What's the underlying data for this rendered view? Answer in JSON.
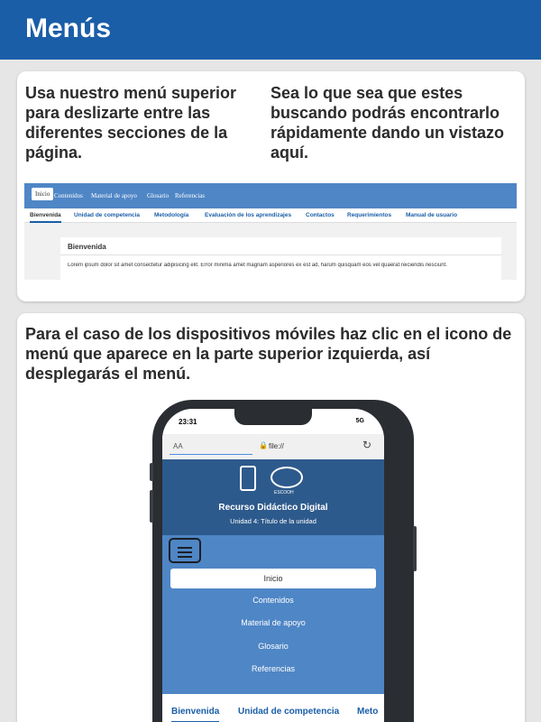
{
  "header": {
    "title": "Menús"
  },
  "card1": {
    "left_text": "Usa nuestro menú superior para deslizarte entre las diferentes secciones de la página.",
    "right_text": "Sea lo que sea que estes buscando podrás encontrarlo rápidamente dando un vistazo aquí."
  },
  "desktop": {
    "nav": [
      "Inicio",
      "Contenidos",
      "Material de apoyo",
      "Glosario",
      "Referencias"
    ],
    "tabs": [
      "Bienvenida",
      "Unidad de competencia",
      "Metodología",
      "Evaluación de los aprendizajes",
      "Contactos",
      "Requerimientos",
      "Manual de usuario"
    ],
    "box_title": "Bienvenida",
    "lorem": "Lorem ipsum dolor sit amet consectetur adipisicing elit. Error minima amet magnam asperiores ex est ad, harum quisquam eos vel quaerat reiciendis nesciunt."
  },
  "card2": {
    "text": "Para el caso de los dispositivos móviles haz clic en el icono de menú que aparece en la parte superior izquierda, así desplegarás el menú."
  },
  "phone": {
    "time": "23:31",
    "signal": "5G",
    "aa": "AA",
    "url": "file://",
    "logo_text": "ESCOOH",
    "title": "Recurso Didáctico Digital",
    "subtitle": "Unidad 4: Título de la unidad",
    "menu": [
      "Inicio",
      "Contenidos",
      "Material de apoyo",
      "Glosario",
      "Referencias"
    ],
    "tabs": [
      "Bienvenida",
      "Unidad de competencia",
      "Meto"
    ]
  }
}
